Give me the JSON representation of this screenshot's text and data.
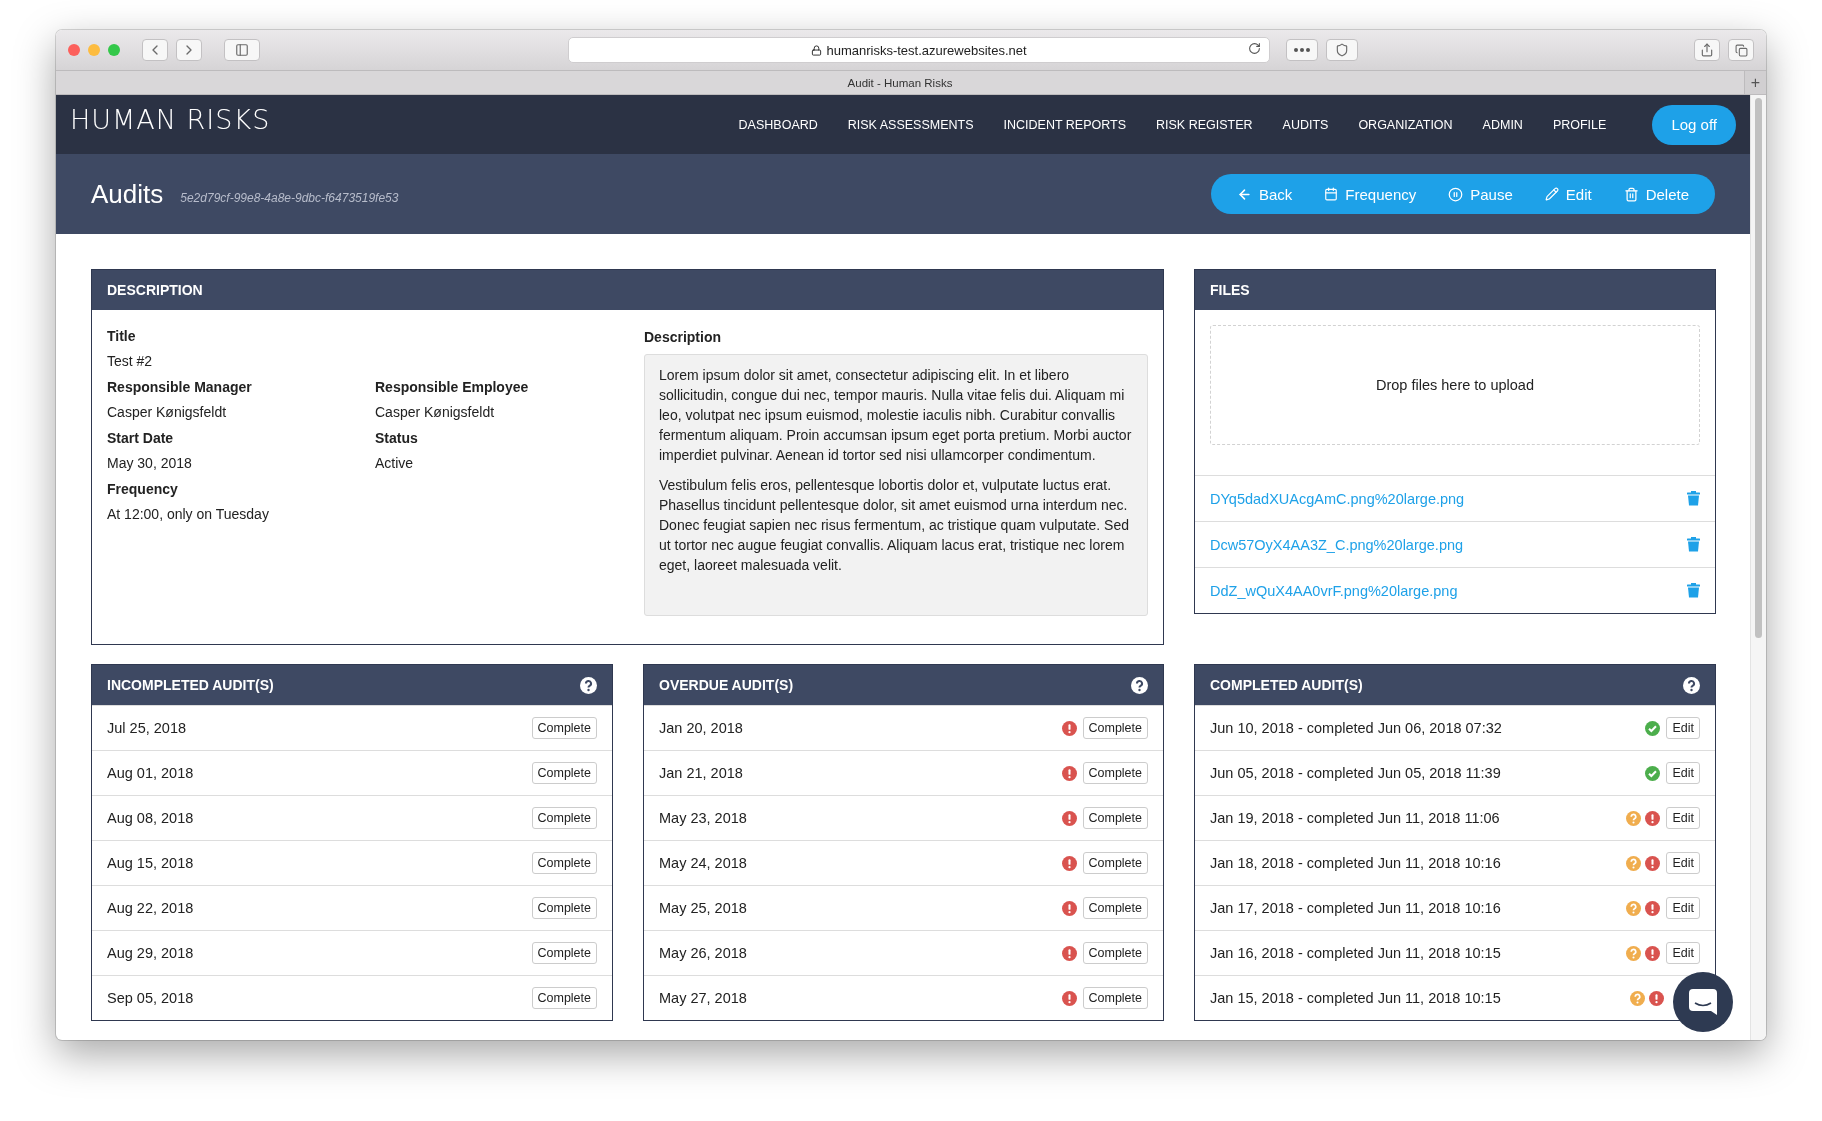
{
  "browser": {
    "url": "humanrisks-test.azurewebsites.net",
    "tab_title": "Audit - Human Risks",
    "new_tab": "+"
  },
  "nav": {
    "logo": "HUMAN RISKS",
    "items": [
      "DASHBOARD",
      "RISK ASSESSMENTS",
      "INCIDENT REPORTS",
      "RISK REGISTER",
      "AUDITS",
      "ORGANIZATION",
      "ADMIN",
      "PROFILE"
    ],
    "logoff": "Log off"
  },
  "page_header": {
    "title": "Audits",
    "id": "5e2d79cf-99e8-4a8e-9dbc-f6473519fe53",
    "actions": [
      {
        "kind": "back",
        "label": "Back"
      },
      {
        "kind": "frequency",
        "label": "Frequency"
      },
      {
        "kind": "pause",
        "label": "Pause"
      },
      {
        "kind": "edit",
        "label": "Edit"
      },
      {
        "kind": "delete",
        "label": "Delete"
      }
    ]
  },
  "description": {
    "title": "DESCRIPTION",
    "rows": [
      [
        {
          "label": "Title",
          "value": "Test #2"
        }
      ],
      [
        {
          "label": "Responsible Manager",
          "value": "Casper Kønigsfeldt"
        },
        {
          "label": "Responsible Employee",
          "value": "Casper Kønigsfeldt"
        }
      ],
      [
        {
          "label": "Start Date",
          "value": "May 30, 2018"
        },
        {
          "label": "Status",
          "value": "Active"
        }
      ],
      [
        {
          "label": "Frequency",
          "value": "At 12:00, only on Tuesday"
        }
      ]
    ],
    "text_label": "Description",
    "paragraphs": [
      "Lorem ipsum dolor sit amet, consectetur adipiscing elit. In et libero sollicitudin, congue dui nec, tempor mauris. Nulla vitae felis dui. Aliquam mi leo, volutpat nec ipsum euismod, molestie iaculis nibh. Curabitur convallis fermentum aliquam. Proin accumsan ipsum eget porta pretium. Morbi auctor imperdiet pulvinar. Aenean id tortor sed nisi ullamcorper condimentum.",
      "Vestibulum felis eros, pellentesque lobortis dolor et, vulputate luctus erat. Phasellus tincidunt pellentesque dolor, sit amet euismod urna interdum nec. Donec feugiat sapien nec risus fermentum, ac tristique quam vulputate. Sed ut tortor nec augue feugiat convallis. Aliquam lacus erat, tristique nec lorem eget, laoreet malesuada velit."
    ]
  },
  "files": {
    "title": "FILES",
    "dropzone": "Drop files here to upload",
    "items": [
      "DYq5dadXUAcgAmC.png%20large.png",
      "Dcw57OyX4AA3Z_C.png%20large.png",
      "DdZ_wQuX4AA0vrF.png%20large.png"
    ]
  },
  "panels": [
    {
      "title": "INCOMPLETED AUDIT(S)",
      "rows": [
        {
          "text": "Jul 25, 2018",
          "overdue": false,
          "action": "Complete"
        },
        {
          "text": "Aug 01, 2018",
          "overdue": false,
          "action": "Complete"
        },
        {
          "text": "Aug 08, 2018",
          "overdue": false,
          "action": "Complete"
        },
        {
          "text": "Aug 15, 2018",
          "overdue": false,
          "action": "Complete"
        },
        {
          "text": "Aug 22, 2018",
          "overdue": false,
          "action": "Complete"
        },
        {
          "text": "Aug 29, 2018",
          "overdue": false,
          "action": "Complete"
        },
        {
          "text": "Sep 05, 2018",
          "overdue": false,
          "action": "Complete"
        }
      ]
    },
    {
      "title": "OVERDUE AUDIT(S)",
      "rows": [
        {
          "text": "Jan 20, 2018",
          "overdue": true,
          "action": "Complete"
        },
        {
          "text": "Jan 21, 2018",
          "overdue": true,
          "action": "Complete"
        },
        {
          "text": "May 23, 2018",
          "overdue": true,
          "action": "Complete"
        },
        {
          "text": "May 24, 2018",
          "overdue": true,
          "action": "Complete"
        },
        {
          "text": "May 25, 2018",
          "overdue": true,
          "action": "Complete"
        },
        {
          "text": "May 26, 2018",
          "overdue": true,
          "action": "Complete"
        },
        {
          "text": "May 27, 2018",
          "overdue": true,
          "action": "Complete"
        }
      ]
    },
    {
      "title": "COMPLETED AUDIT(S)",
      "rows": [
        {
          "text": "Jun 10, 2018 - completed Jun 06, 2018 07:32",
          "approved": true,
          "unverified": false,
          "overdue": false,
          "action": "Edit"
        },
        {
          "text": "Jun 05, 2018 - completed Jun 05, 2018 11:39",
          "approved": true,
          "unverified": false,
          "overdue": false,
          "action": "Edit"
        },
        {
          "text": "Jan 19, 2018 - completed Jun 11, 2018 11:06",
          "approved": false,
          "unverified": true,
          "overdue": true,
          "action": "Edit"
        },
        {
          "text": "Jan 18, 2018 - completed Jun 11, 2018 10:16",
          "approved": false,
          "unverified": true,
          "overdue": true,
          "action": "Edit"
        },
        {
          "text": "Jan 17, 2018 - completed Jun 11, 2018 10:16",
          "approved": false,
          "unverified": true,
          "overdue": true,
          "action": "Edit"
        },
        {
          "text": "Jan 16, 2018 - completed Jun 11, 2018 10:15",
          "approved": false,
          "unverified": true,
          "overdue": true,
          "action": "Edit"
        },
        {
          "text": "Jan 15, 2018 - completed Jun 11, 2018 10:15",
          "approved": false,
          "unverified": true,
          "overdue": true
        }
      ]
    }
  ]
}
